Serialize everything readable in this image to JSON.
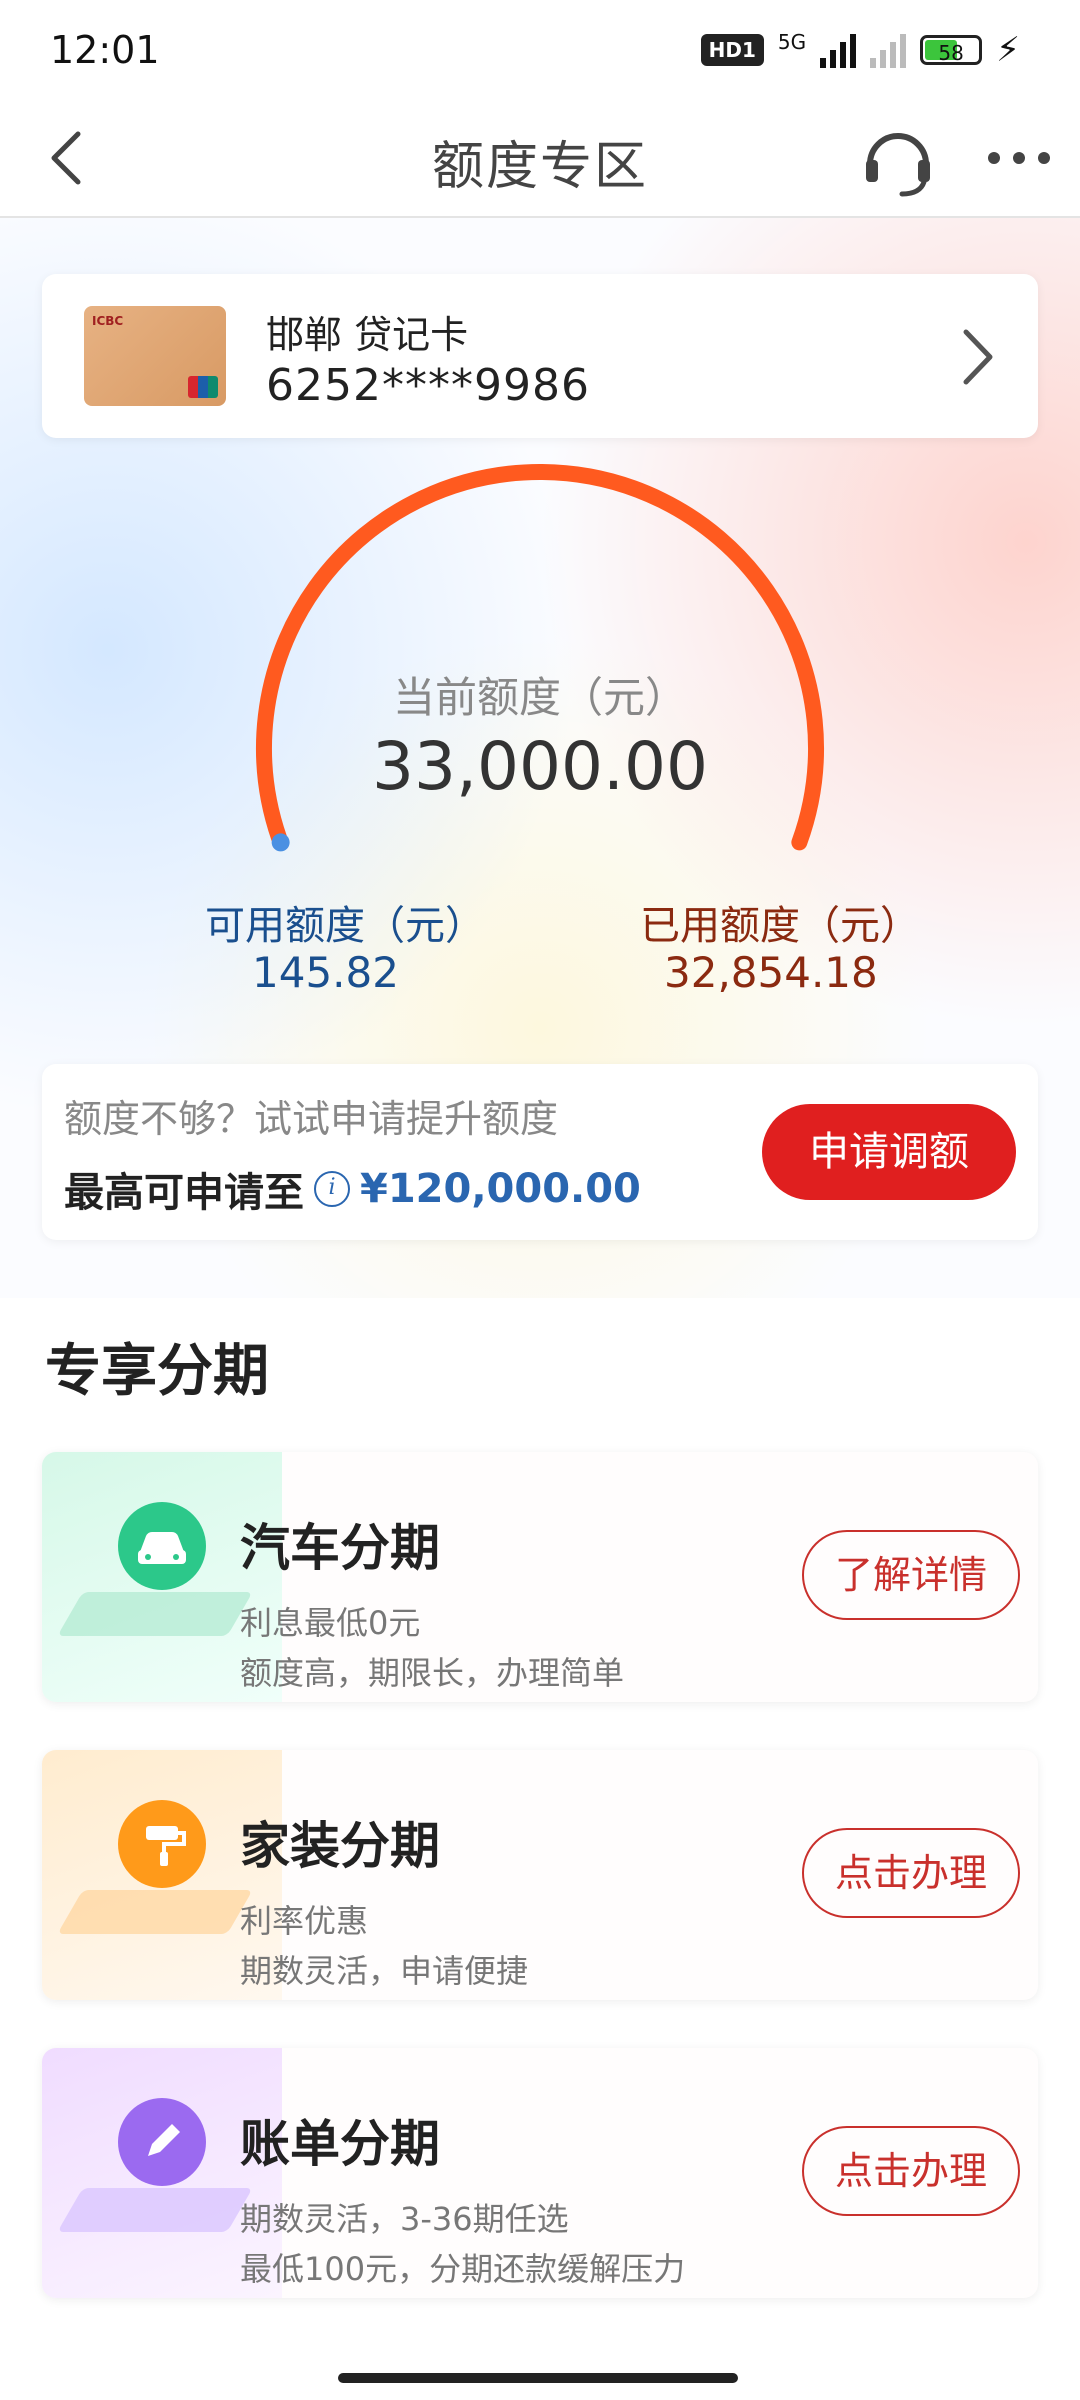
{
  "status_bar": {
    "time": "12:01",
    "network_badge": "HD1",
    "network_type": "5G",
    "battery": "58"
  },
  "nav": {
    "title": "额度专区"
  },
  "card": {
    "name": "邯郸 贷记卡",
    "number": "6252****9986",
    "bank_logo_text": "ICBC"
  },
  "gauge": {
    "label": "当前额度（元）",
    "value": "33,000.00",
    "available_label": "可用额度（元）",
    "available_value": "145.82",
    "used_label": "已用额度（元）",
    "used_value": "32,854.18",
    "used_fraction": 0.9956,
    "arc_color": "#ff5a1f"
  },
  "raise": {
    "hint": "额度不够？试试申请提升额度",
    "max_label": "最高可申请至",
    "max_amount": "¥120,000.00",
    "button": "申请调额"
  },
  "section": {
    "title": "专享分期"
  },
  "promos": [
    {
      "title": "汽车分期",
      "line1": "利息最低0元",
      "line2": "额度高，期限长，办理简单",
      "button": "了解详情",
      "icon": "car-icon",
      "color": "#2cc88a"
    },
    {
      "title": "家装分期",
      "line1": "利率优惠",
      "line2": "期数灵活，申请便捷",
      "button": "点击办理",
      "icon": "paint-roller-icon",
      "color": "#ff9a1a"
    },
    {
      "title": "账单分期",
      "line1": "期数灵活，3-36期任选",
      "line2": "最低100元，分期还款缓解压力",
      "button": "点击办理",
      "icon": "pencil-icon",
      "color": "#9b6af0"
    }
  ]
}
